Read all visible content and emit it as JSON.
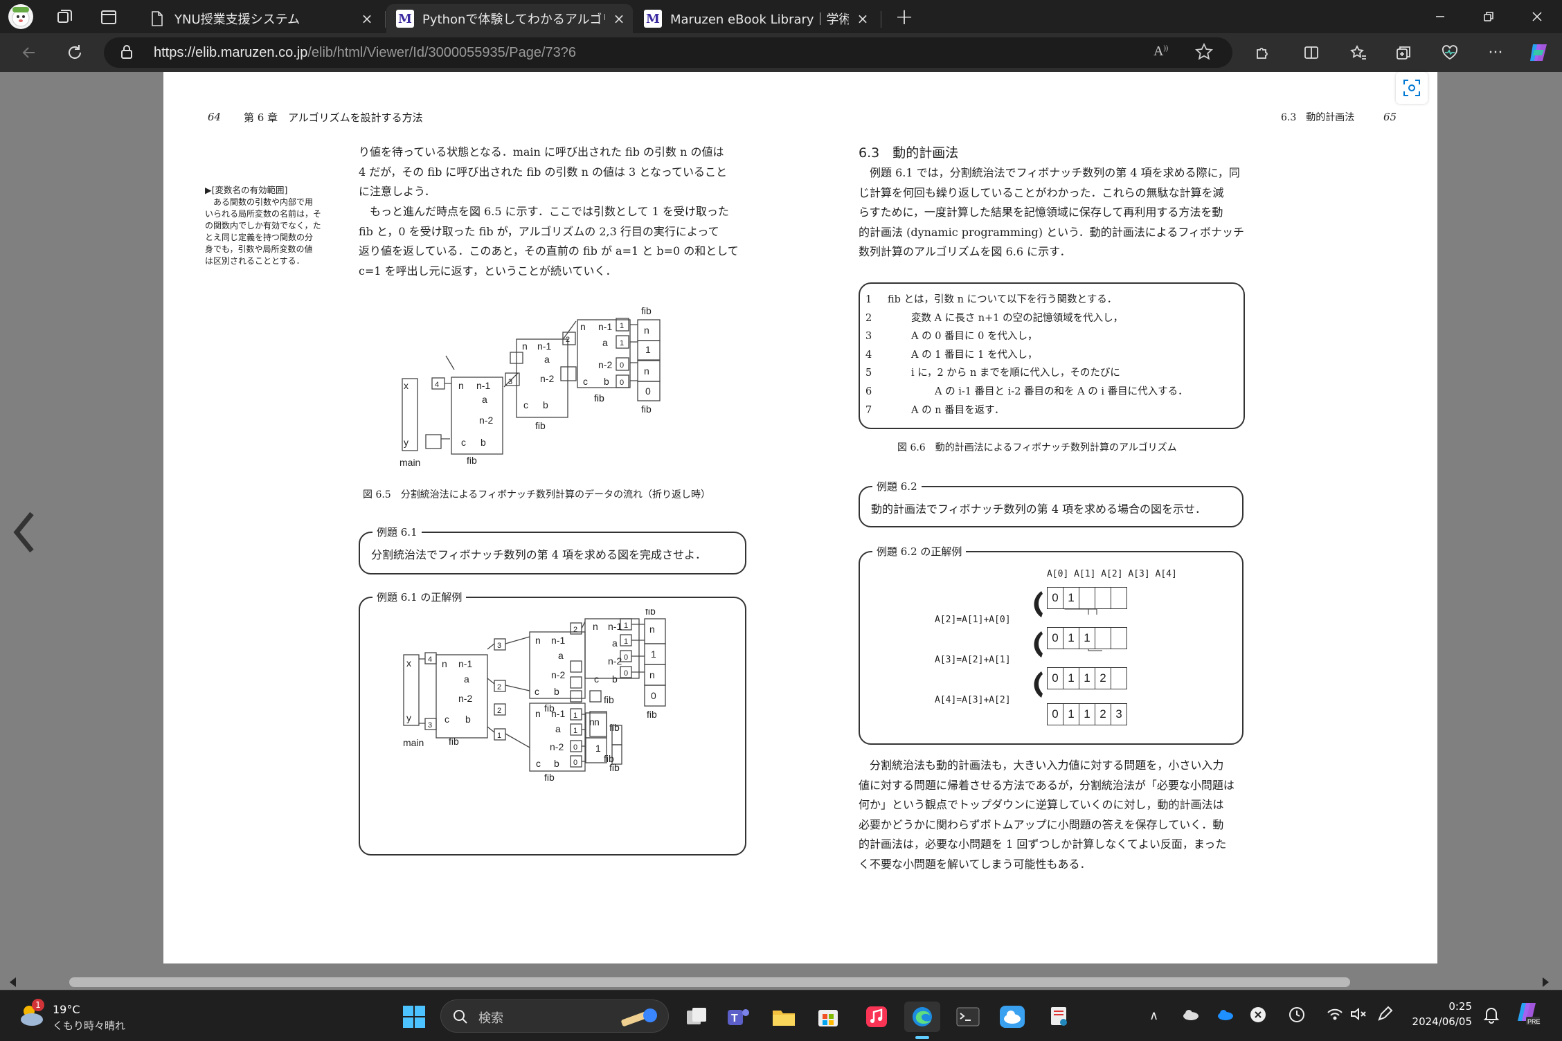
{
  "browser": {
    "tabs": [
      {
        "title": "YNU授業支援システム",
        "close": "×",
        "active": false
      },
      {
        "title": "Pythonで体験してわかるアルゴリズム",
        "close": "×",
        "active": true
      },
      {
        "title": "Maruzen eBook Library｜学術・専",
        "close": "×",
        "active": false
      }
    ],
    "new_tab": "+",
    "url_host": "https://elib.maruzen.co.jp",
    "url_path": "/elib/html/Viewer/Id/3000055935/Page/73?6"
  },
  "book": {
    "left": {
      "page_no": "64",
      "running_head": "第 6 章　アルゴリズムを設計する方法",
      "margin_note_title": "▶[変数名の有効範囲]",
      "margin_note": [
        "ある関数の引数や内部で用",
        "いられる局所変数の名前は，そ",
        "の関数内でしか有効でなく，た",
        "とえ同じ定義を持つ関数の分",
        "身でも，引数や局所変数の値",
        "は区別されることとする．"
      ],
      "para1": [
        "り値を待っている状態となる．main に呼び出された fib の引数 n の値は",
        "4 だが，その fib に呼び出された fib の引数 n の値は 3 となっていること",
        "に注意しよう．"
      ],
      "para2": [
        "　もっと進んだ時点を図 6.5 に示す．ここでは引数として 1 を受け取った",
        "fib と，0 を受け取った fib が，アルゴリズムの 2,3 行目の実行によって",
        "返り値を返している．このあと，その直前の fib が a=1 と b=0 の和として",
        "c=1 を呼出し元に返す，ということが続いていく．"
      ],
      "fig65_caption": "図 6.5　分割統治法によるフィボナッチ数列計算のデータの流れ（折り返し時）",
      "ex61_label": "例題 6.1",
      "ex61_text": "分割統治法でフィボナッチ数列の第 4 項を求める図を完成させよ．",
      "ex61ans_label": "例題 6.1 の正解例"
    },
    "right": {
      "page_no": "65",
      "running_head": "6.3　動的計画法",
      "section_title": "6.3　動的計画法",
      "intro": [
        "　例題 6.1 では，分割統治法でフィボナッチ数列の第 4 項を求める際に，同",
        "じ計算を何回も繰り返していることがわかった．これらの無駄な計算を減",
        "らすために，一度計算した結果を記憶領域に保存して再利用する方法を動",
        "的計画法 (dynamic programming) という．動的計画法によるフィボナッチ",
        "数列計算のアルゴリズムを図 6.6 に示す．"
      ],
      "algorithm": [
        {
          "n": "1",
          "t": "fib とは，引数 n について以下を行う関数とする．",
          "indent": 0
        },
        {
          "n": "2",
          "t": "変数 A に長さ n+1 の空の記憶領域を代入し，",
          "indent": 1
        },
        {
          "n": "3",
          "t": "A の 0 番目に 0 を代入し，",
          "indent": 1
        },
        {
          "n": "4",
          "t": "A の 1 番目に 1 を代入し，",
          "indent": 1
        },
        {
          "n": "5",
          "t": "i に，2 から n までを順に代入し，そのたびに",
          "indent": 1
        },
        {
          "n": "6",
          "t": "A の i-1 番目と i-2 番目の和を A の i 番目に代入する．",
          "indent": 2
        },
        {
          "n": "7",
          "t": "A の n 番目を返す．",
          "indent": 1
        }
      ],
      "fig66_caption": "図 6.6　動的計画法によるフィボナッチ数列計算のアルゴリズム",
      "ex62_label": "例題 6.2",
      "ex62_text": "動的計画法でフィボナッチ数列の第 4 項を求める場合の図を示せ．",
      "ex62ans_label": "例題 6.2 の正解例",
      "array_header": "A[0] A[1] A[2] A[3] A[4]",
      "formulas": [
        "A[2]=A[1]+A[0]",
        "A[3]=A[2]+A[1]",
        "A[4]=A[3]+A[2]"
      ],
      "array_rows": [
        [
          "0",
          "1",
          "",
          "",
          ""
        ],
        [
          "0",
          "1",
          "1",
          "",
          ""
        ],
        [
          "0",
          "1",
          "1",
          "2",
          ""
        ],
        [
          "0",
          "1",
          "1",
          "2",
          "3"
        ]
      ],
      "closing": [
        "　分割統治法も動的計画法も，大きい入力値に対する問題を，小さい入力",
        "値に対する問題に帰着させる方法であるが，分割統治法が「必要な小問題は",
        "何か」という観点でトップダウンに逆算していくのに対し，動的計画法は",
        "必要かどうかに関わらずボトムアップに小問題の答えを保存していく．動",
        "的計画法は，必要な小問題を 1 回ずつしか計算しなくてよい反面，まった",
        "く不要な小問題を解いてしまう可能性もある．"
      ]
    }
  },
  "diagram_labels": {
    "fib": "fib",
    "main": "main",
    "x": "x",
    "y": "y",
    "n": "n",
    "n1": "n-1",
    "n2": "n-2",
    "a": "a",
    "b": "b",
    "c": "c"
  },
  "taskbar": {
    "weather_temp": "19°C",
    "weather_desc": "くもり時々晴れ",
    "weather_badge": "1",
    "search_placeholder": "検索",
    "time": "0:25",
    "date": "2024/06/05"
  },
  "colors": {
    "accent": "#0078d4",
    "edge_blue": "#3aa0ff"
  }
}
